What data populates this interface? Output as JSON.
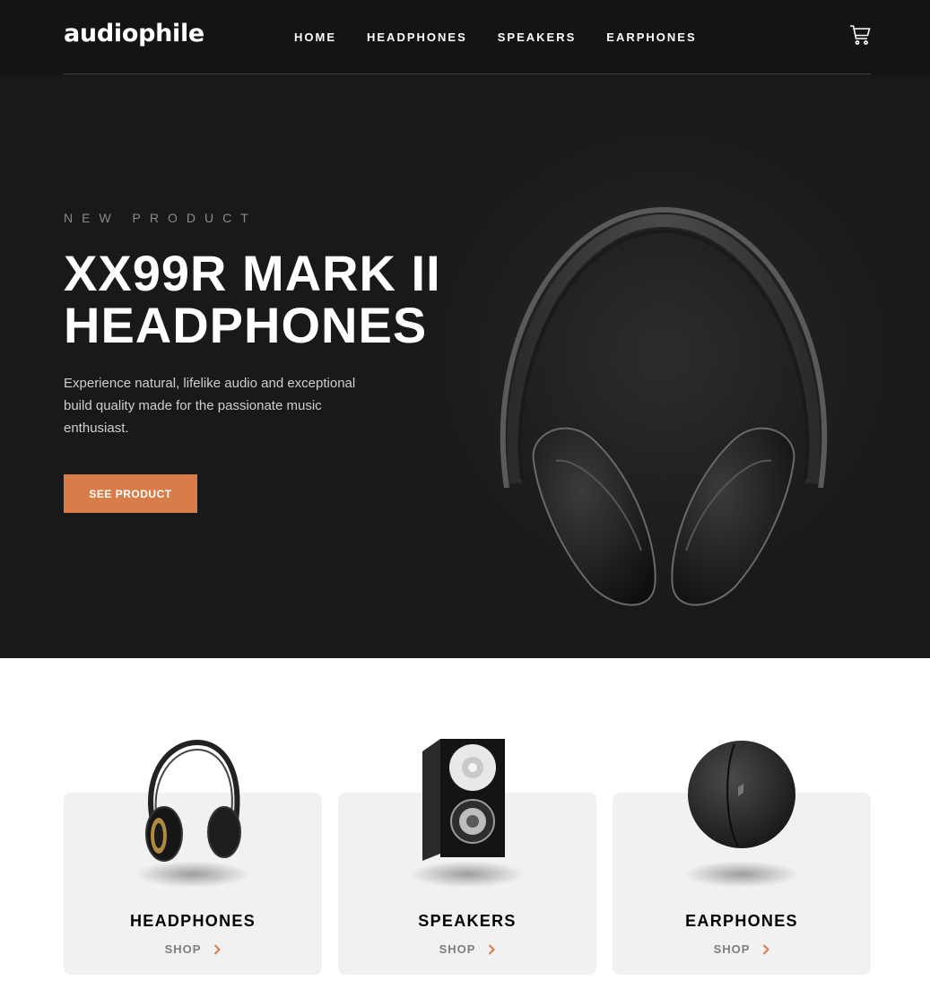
{
  "header": {
    "logo": "audiophile",
    "nav": [
      "HOME",
      "HEADPHONES",
      "SPEAKERS",
      "EARPHONES"
    ],
    "cart_icon": "cart-icon"
  },
  "hero": {
    "overline": "NEW PRODUCT",
    "title": "XX99R MARK II HEADPHONES",
    "description": "Experience natural, lifelike audio and exceptional build quality made for the passionate music enthusiast.",
    "button_label": "SEE PRODUCT"
  },
  "categories": [
    {
      "title": "HEADPHONES",
      "shop_label": "SHOP"
    },
    {
      "title": "SPEAKERS",
      "shop_label": "SHOP"
    },
    {
      "title": "EARPHONES",
      "shop_label": "SHOP"
    }
  ],
  "colors": {
    "accent": "#D87D4A",
    "header_bg": "#141414",
    "hero_bg": "#191919",
    "card_bg": "#F1F1F1"
  }
}
